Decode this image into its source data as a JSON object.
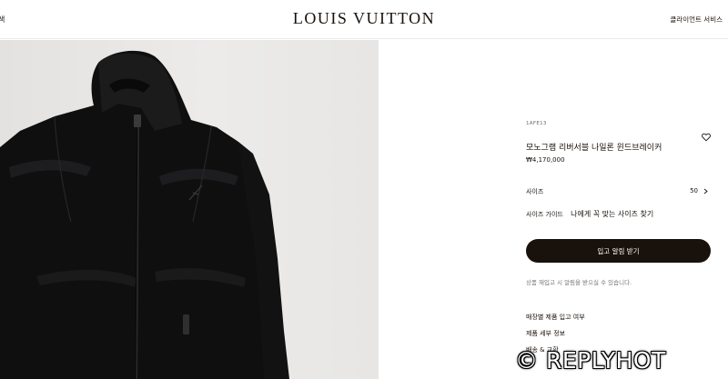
{
  "header": {
    "left_text": "색",
    "logo": "LOUIS VUITTON",
    "right_text": "클라이언트 서비스"
  },
  "product": {
    "sku": "1AFE13",
    "title": "모노그램 리버서블 나일론 윈드브레이커",
    "price": "₩4,170,000",
    "image_alt": "black nylon hooded windbreaker"
  },
  "size": {
    "label": "사이즈",
    "value": "50"
  },
  "guide": {
    "label": "사이즈 가이드",
    "link": "나에게 꼭 맞는 사이즈 찾기"
  },
  "cta": {
    "label": "입고 알림 받기"
  },
  "note": "상품 재입고 시 알림을 받으실 수 있습니다.",
  "links": [
    "매장별 제품 입고 여부",
    "제품 세부 정보",
    "배송 & 교환"
  ],
  "watermark": "© REPLYHOT",
  "colors": {
    "brand_dark": "#19110b",
    "image_bg": "#e8e7e5"
  },
  "icons": [
    "heart-icon",
    "chevron-right-icon"
  ]
}
